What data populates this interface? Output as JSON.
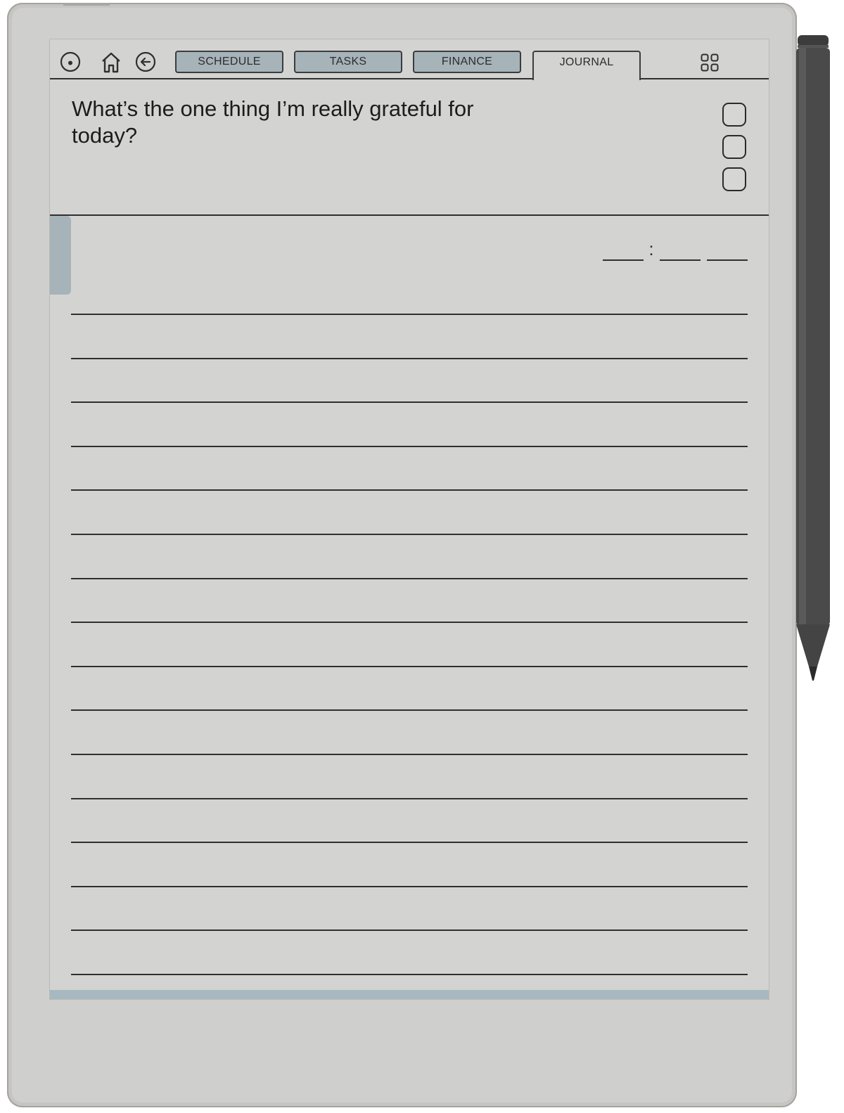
{
  "topbar": {
    "menu_icon": "circle-dot-icon",
    "home_icon": "home-icon",
    "back_icon": "back-arrow-icon",
    "tabs": [
      {
        "label": "SCHEDULE",
        "active": false
      },
      {
        "label": "TASKS",
        "active": false
      },
      {
        "label": "FINANCE",
        "active": false
      },
      {
        "label": "JOURNAL",
        "active": true
      }
    ],
    "apps_icon": "grid-icon"
  },
  "journal": {
    "prompt": "What’s the one thing I’m really grateful for today?",
    "checkbox_count": 3,
    "time_separator": ":",
    "ruled_line_count": 16
  },
  "colors": {
    "screen": "#d3d4d2",
    "accent": "#a6b3b9",
    "ink": "#2f2f2f",
    "device": "#cfcfcd",
    "bottom_strip": "#a8b8c0"
  }
}
